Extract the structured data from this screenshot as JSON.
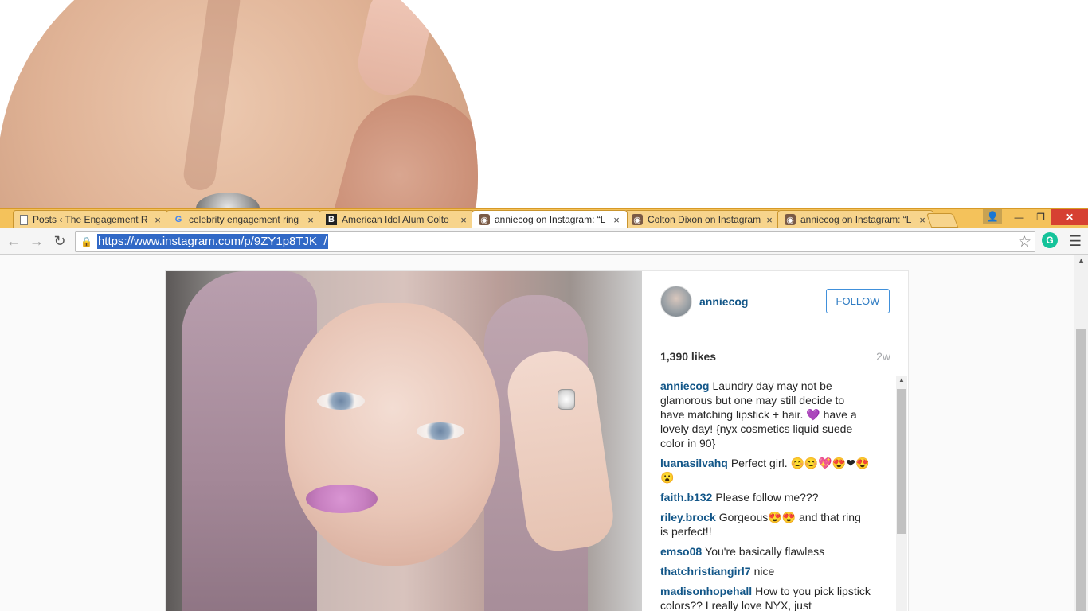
{
  "browser": {
    "tabs": [
      {
        "title": "Posts ‹ The Engagement R",
        "favicon": "page-icon",
        "active": false
      },
      {
        "title": "celebrity engagement ring",
        "favicon": "google-icon",
        "active": false
      },
      {
        "title": "American Idol Alum Colto",
        "favicon": "b-logo-icon",
        "active": false
      },
      {
        "title": "anniecog on Instagram: “L",
        "favicon": "instagram-icon",
        "active": true
      },
      {
        "title": "Colton Dixon on Instagram",
        "favicon": "instagram-icon",
        "active": false
      },
      {
        "title": "anniecog on Instagram: “L",
        "favicon": "instagram-icon",
        "active": false
      }
    ],
    "tab_close_glyph": "×",
    "url": "https://www.instagram.com/p/9ZY1p8TJK_/"
  },
  "post": {
    "username": "anniecog",
    "follow_label": "FOLLOW",
    "likes": "1,390 likes",
    "time_ago": "2w",
    "comments": [
      {
        "user": "anniecog",
        "text": "Laundry day may not be glamorous but one may still decide to have matching lipstick + hair. 💜 have a lovely day! {nyx cosmetics liquid suede color in 90}"
      },
      {
        "user": "luanasilvahq",
        "text": "Perfect girl. 😊😊💖😍❤😍😮"
      },
      {
        "user": "faith.b132",
        "text": "Please follow me???"
      },
      {
        "user": "riley.brock",
        "text": "Gorgeous😍😍 and that ring is perfect!!"
      },
      {
        "user": "emso08",
        "text": "You're basically flawless"
      },
      {
        "user": "thatchristiangirl7",
        "text": "nice"
      },
      {
        "user": "madisonhopehall",
        "text": "How to you pick lipstick colors?? I really love NYX, just"
      }
    ]
  },
  "colors": {
    "tabstrip": "#f4c25b",
    "link_blue": "#125688",
    "selection": "#3169c6",
    "close_red": "#d64032"
  }
}
